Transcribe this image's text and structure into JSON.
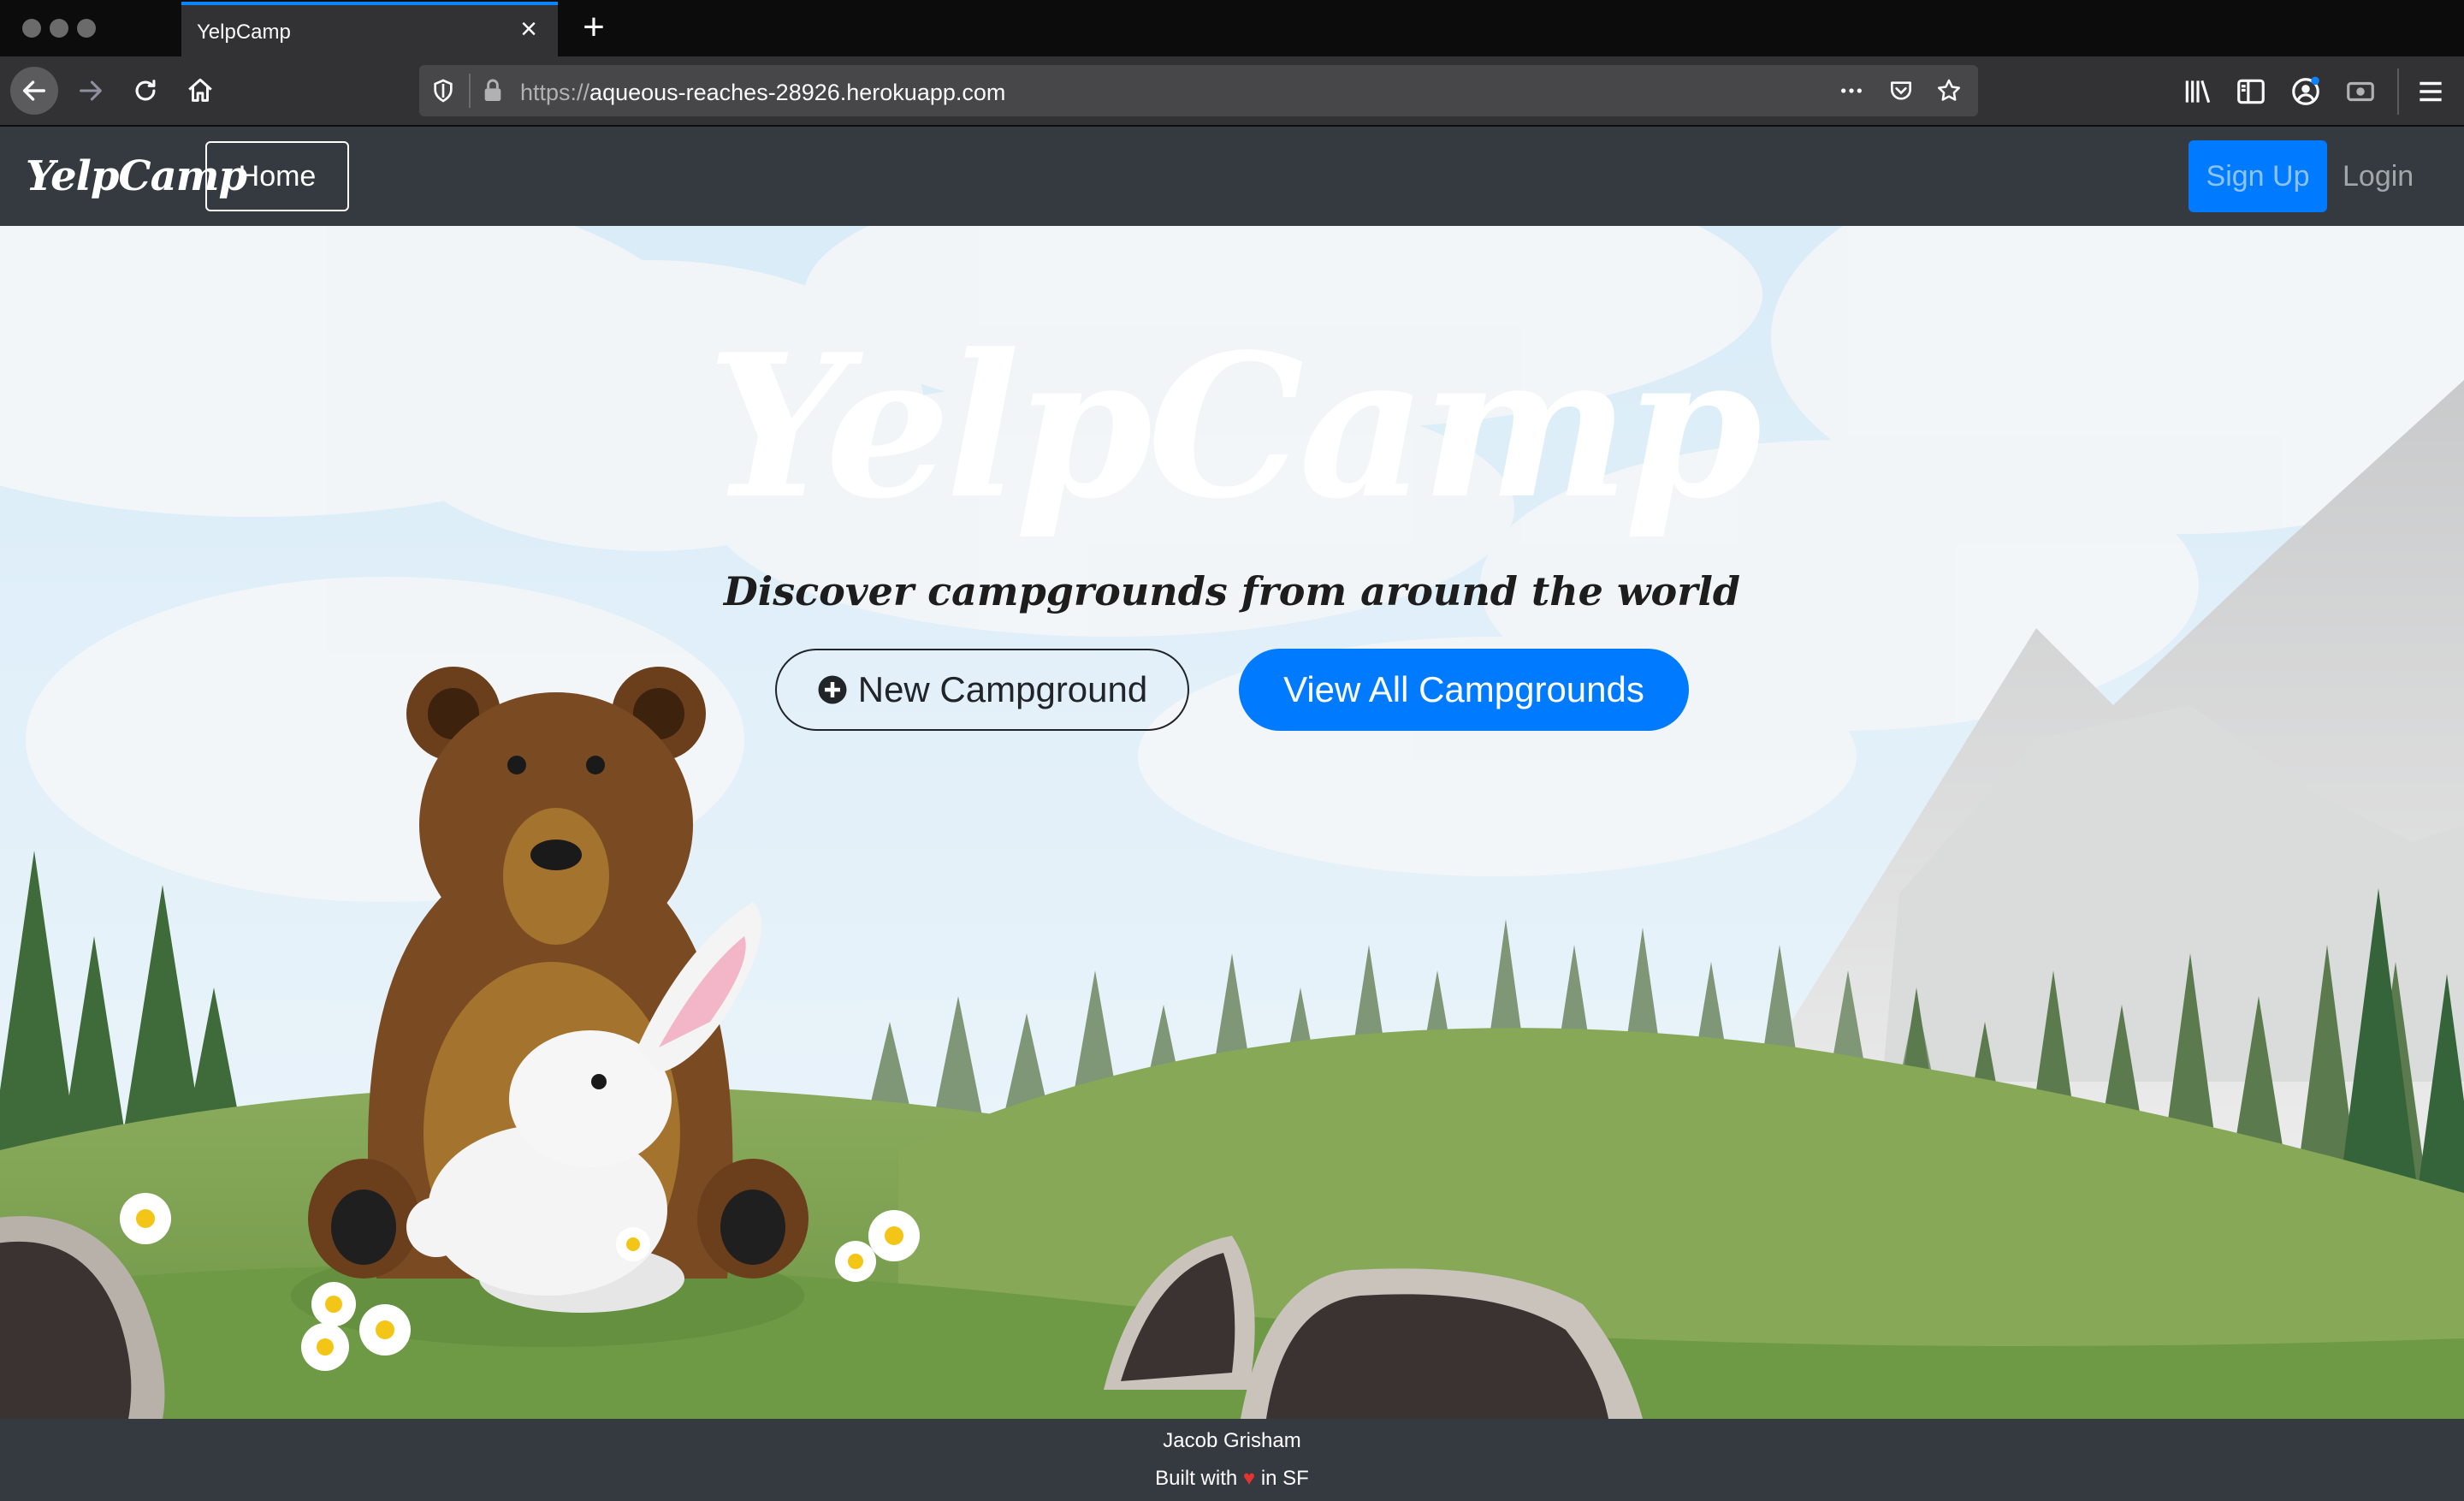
{
  "browser": {
    "tab_title": "YelpCamp",
    "tab_close": "×",
    "new_tab": "+",
    "url_scheme": "https://",
    "url_host": "aqueous-reaches-28926.herokuapp.com",
    "accent_color": "#0a84ff",
    "icons": [
      "back-arrow-icon",
      "forward-arrow-icon",
      "reload-icon",
      "home-icon",
      "shield-icon",
      "lock-icon",
      "more-icon",
      "pocket-icon",
      "bookmark-star-icon",
      "library-icon",
      "sidebar-icon",
      "account-icon",
      "screenshot-icon",
      "hamburger-menu-icon"
    ]
  },
  "site_nav": {
    "brand": "YelpCamp",
    "home": "Home",
    "signup": "Sign Up",
    "login": "Login",
    "primary_color": "#007bff"
  },
  "hero": {
    "title": "YelpCamp",
    "subtitle": "Discover campgrounds from around the world",
    "new_campground": "New Campground",
    "view_all": "View All Campgrounds",
    "plus_icon": "plus-circle-icon"
  },
  "footer": {
    "name": "Jacob Grisham",
    "built_prefix": "Built with",
    "heart": "♥",
    "built_suffix": "in SF"
  }
}
